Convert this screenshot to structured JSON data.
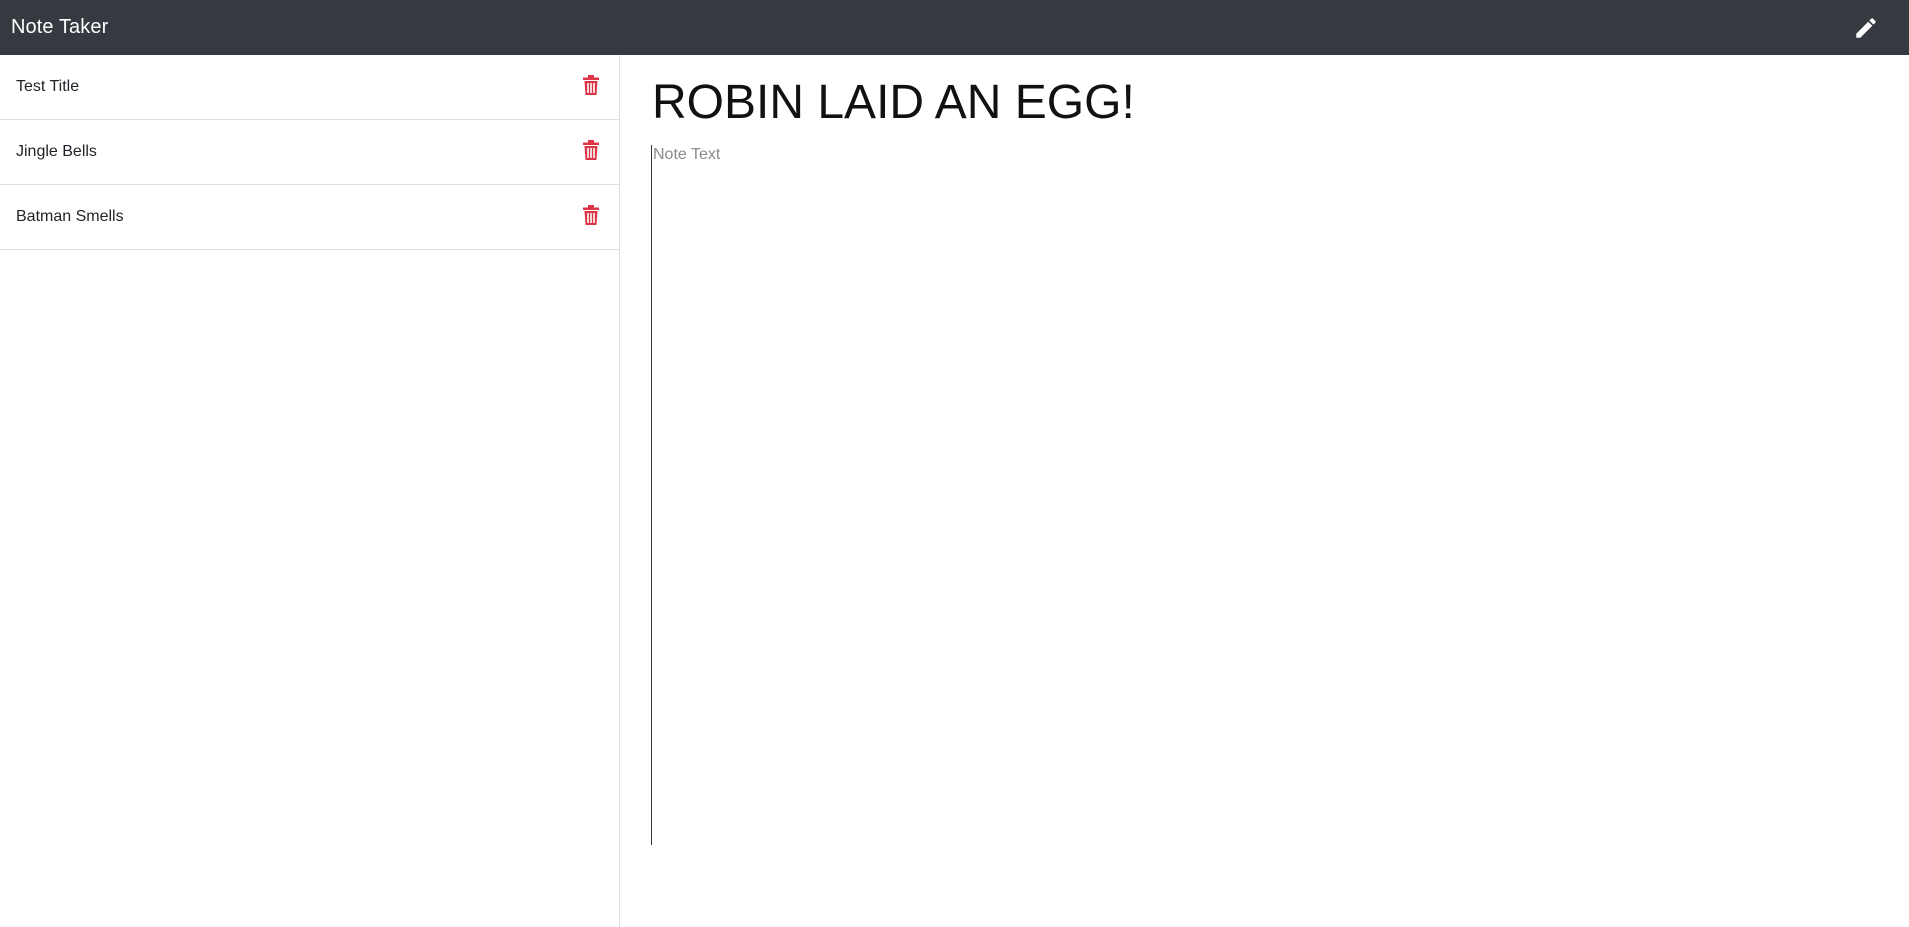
{
  "app": {
    "title": "Note Taker"
  },
  "header": {
    "new_note_icon": "pencil-icon"
  },
  "colors": {
    "navbar": "#343a40",
    "delete": "#dc3545"
  },
  "notes": [
    {
      "title": "Test Title"
    },
    {
      "title": "Jingle Bells"
    },
    {
      "title": "Batman Smells"
    }
  ],
  "editor": {
    "title_value": "ROBIN LAID AN EGG!",
    "text_value": "",
    "text_placeholder": "Note Text"
  }
}
